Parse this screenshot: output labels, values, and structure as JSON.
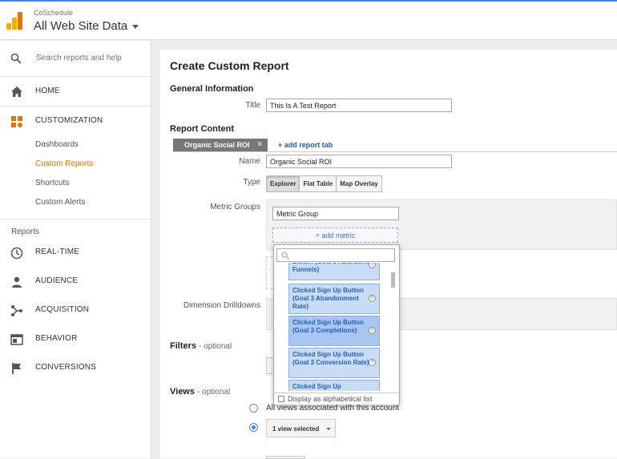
{
  "header": {
    "account_name": "CoSchedule",
    "property_name": "All Web Site Data"
  },
  "sidebar": {
    "search_placeholder": "Search reports and help",
    "home": "HOME",
    "customization": "CUSTOMIZATION",
    "sub_items": [
      "Dashboards",
      "Custom Reports",
      "Shortcuts",
      "Custom Alerts"
    ],
    "reports_label": "Reports",
    "reports": [
      "REAL-TIME",
      "AUDIENCE",
      "ACQUISITION",
      "BEHAVIOR",
      "CONVERSIONS"
    ]
  },
  "main": {
    "title": "Create Custom Report",
    "general_info": "General Information",
    "title_label": "Title",
    "title_value": "This Is A Test Report",
    "report_content": "Report Content",
    "tab_name": "Organic Social ROI",
    "tab_close": "×",
    "add_tab": "+ add report tab",
    "name_label": "Name",
    "name_value": "Organic Social ROI",
    "type_label": "Type",
    "type_options": [
      "Explorer",
      "Flat Table",
      "Map Overlay"
    ],
    "metric_groups_label": "Metric Groups",
    "metric_group_value": "Metric Group",
    "add_metric": "+ add metric",
    "dimension_label": "Dimension Drilldowns",
    "filters_label": "Filters",
    "filters_optional": "- optional",
    "views_label": "Views",
    "views_optional": "- optional",
    "all_views": "All views associated with this account",
    "view_selected": "1 view selected"
  },
  "dropdown": {
    "items": [
      "Button (Goal 3 Abandoned Funnels)",
      "Clicked Sign Up Button (Goal 3 Abandonment Rate)",
      "Clicked Sign Up Button (Goal 3 Completions)",
      "Clicked Sign Up Button (Goal 3 Conversion Rate)",
      "Clicked Sign Up"
    ],
    "help_glyph": "?",
    "alphabetical": "Display as alphabetical list"
  },
  "colors": {
    "accent": "#e37400",
    "link": "#1a5fb4",
    "top_bar": "#4285f4"
  }
}
